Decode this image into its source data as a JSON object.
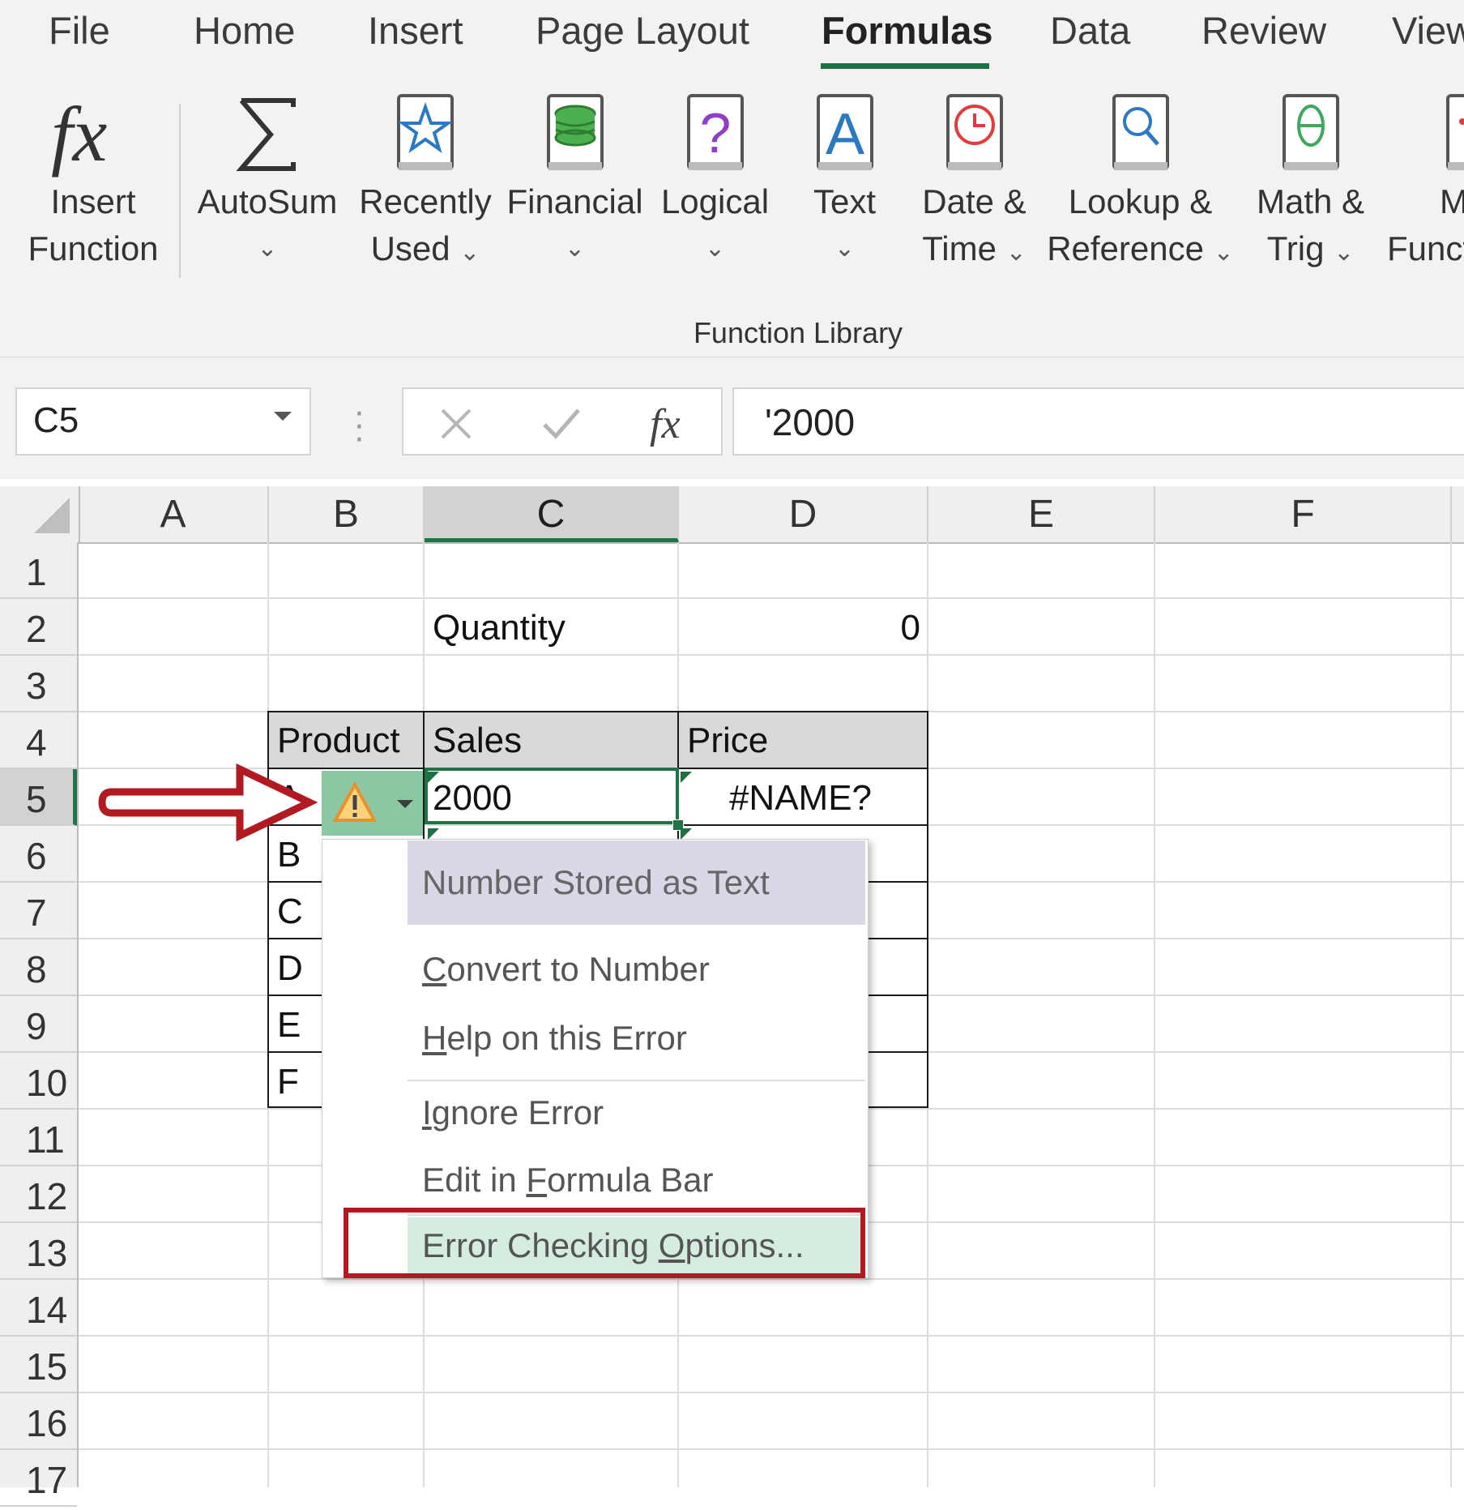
{
  "ribbon": {
    "tabs": [
      "File",
      "Home",
      "Insert",
      "Page Layout",
      "Formulas",
      "Data",
      "Review",
      "View"
    ],
    "active_tab": "Formulas",
    "buttons": [
      {
        "line1": "Insert",
        "line2": "Function",
        "icon": "fx-icon"
      },
      {
        "line1": "AutoSum",
        "line2": "",
        "icon": "sigma-icon"
      },
      {
        "line1": "Recently",
        "line2": "Used",
        "icon": "star-book-icon"
      },
      {
        "line1": "Financial",
        "line2": "",
        "icon": "coins-book-icon"
      },
      {
        "line1": "Logical",
        "line2": "",
        "icon": "question-book-icon"
      },
      {
        "line1": "Text",
        "line2": "",
        "icon": "text-book-icon"
      },
      {
        "line1": "Date &",
        "line2": "Time",
        "icon": "clock-book-icon"
      },
      {
        "line1": "Lookup &",
        "line2": "Reference",
        "icon": "magnifier-book-icon"
      },
      {
        "line1": "Math &",
        "line2": "Trig",
        "icon": "theta-book-icon"
      },
      {
        "line1": "M",
        "line2": "Funct",
        "icon": "more-functions-book-icon"
      }
    ],
    "group_label": "Function Library"
  },
  "formula_bar": {
    "name_box": "C5",
    "fx_label": "fx",
    "value": "'2000"
  },
  "columns": [
    "A",
    "B",
    "C",
    "D",
    "E",
    "F"
  ],
  "selected_column": "C",
  "rows": [
    "1",
    "2",
    "3",
    "4",
    "5",
    "6",
    "7",
    "8",
    "9",
    "10",
    "11",
    "12",
    "13",
    "14",
    "15",
    "16",
    "17"
  ],
  "selected_row": "5",
  "cells": {
    "c2": "Quantity",
    "d2": "0",
    "b4": "Product",
    "c4": "Sales",
    "d4": "Price",
    "b5": "A",
    "c5": "2000",
    "d5": "#NAME?",
    "b6": "B",
    "b7": "C",
    "b8": "D",
    "b9": "E",
    "b10": "F"
  },
  "error_menu": {
    "title": "Number Stored as Text",
    "items": [
      {
        "pre": "",
        "key": "C",
        "post": "onvert to Number"
      },
      {
        "pre": "",
        "key": "H",
        "post": "elp on this Error"
      },
      {
        "pre": "",
        "key": "I",
        "post": "gnore Error"
      },
      {
        "pre": "Edit in ",
        "key": "F",
        "post": "ormula Bar"
      },
      {
        "pre": "Error Checking ",
        "key": "O",
        "post": "ptions..."
      }
    ]
  },
  "colors": {
    "accent": "#217346",
    "annotation": "#b11a21",
    "warning": "#e8912d"
  }
}
